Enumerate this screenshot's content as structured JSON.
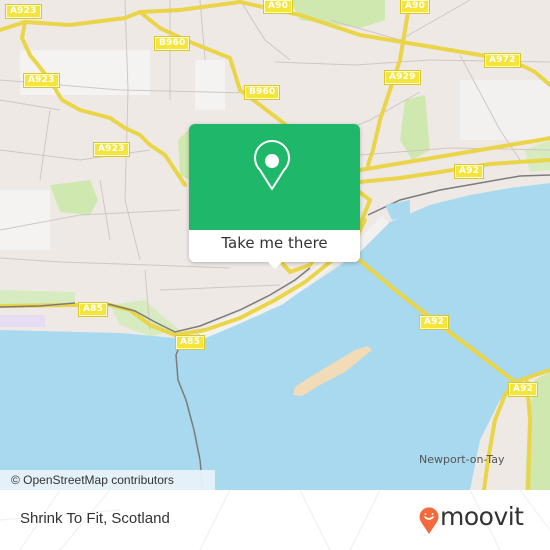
{
  "map": {
    "road_labels": [
      {
        "id": "a923-top",
        "text": "A923"
      },
      {
        "id": "a923-mid",
        "text": "A923"
      },
      {
        "id": "a923-low",
        "text": "A923"
      },
      {
        "id": "b960-top",
        "text": "B960"
      },
      {
        "id": "b960-mid",
        "text": "B960"
      },
      {
        "id": "a90-left",
        "text": "A90"
      },
      {
        "id": "a90-right",
        "text": "A90"
      },
      {
        "id": "a929",
        "text": "A929"
      },
      {
        "id": "a972",
        "text": "A972"
      },
      {
        "id": "a92-east",
        "text": "A92"
      },
      {
        "id": "a92-bridge",
        "text": "A92"
      },
      {
        "id": "a92-south",
        "text": "A92"
      },
      {
        "id": "a85-west",
        "text": "A85"
      },
      {
        "id": "a85-south",
        "text": "A85"
      }
    ],
    "place_labels": {
      "newport": "Newport-on-Tay"
    },
    "attribution": "© OpenStreetMap contributors",
    "colors": {
      "land": "#efe9e6",
      "water": "#a8d9ee",
      "park": "#cfe8b0",
      "road": "#f5e04f",
      "sand": "#f1dcb7"
    }
  },
  "popup": {
    "icon": "map-pin-icon",
    "button_label": "Take me there",
    "color": "#1fb86a"
  },
  "footer": {
    "title": "Shrink To Fit, Scotland",
    "brand": "moovit",
    "brand_color": "#f26a3d"
  }
}
